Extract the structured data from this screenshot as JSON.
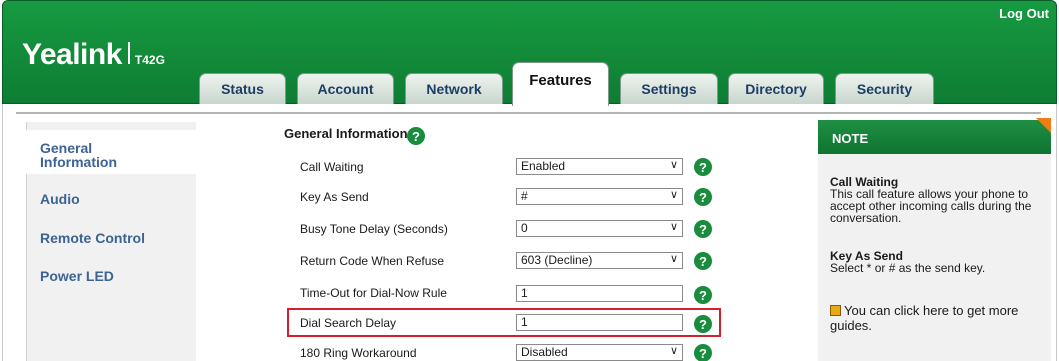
{
  "header": {
    "logout_label": "Log Out",
    "logo_text": "Yealink",
    "model": "T42G"
  },
  "tabs": [
    {
      "label": "Status"
    },
    {
      "label": "Account"
    },
    {
      "label": "Network"
    },
    {
      "label": "Features",
      "active": true
    },
    {
      "label": "Settings"
    },
    {
      "label": "Directory"
    },
    {
      "label": "Security"
    }
  ],
  "sidebar": {
    "items": [
      {
        "label": "General Information",
        "selected": true
      },
      {
        "label": "Audio"
      },
      {
        "label": "Remote Control"
      },
      {
        "label": "Power LED"
      }
    ]
  },
  "section": {
    "title": "General Information",
    "help_icon": "help-icon"
  },
  "rows": [
    {
      "label": "Call Waiting",
      "value": "Enabled",
      "type": "select"
    },
    {
      "label": "Key As Send",
      "value": "#",
      "type": "select"
    },
    {
      "label": "Busy Tone Delay (Seconds)",
      "value": "0",
      "type": "select"
    },
    {
      "label": "Return Code When Refuse",
      "value": "603 (Decline)",
      "type": "select"
    },
    {
      "label": "Time-Out for Dial-Now Rule",
      "value": "1",
      "type": "text"
    },
    {
      "label": "Dial Search Delay",
      "value": "1",
      "type": "text",
      "highlighted": true
    },
    {
      "label": "180 Ring Workaround",
      "value": "Disabled",
      "type": "select"
    }
  ],
  "note": {
    "title": "NOTE",
    "items": [
      {
        "heading": "Call Waiting",
        "text": "This call feature allows your phone to accept other incoming calls during the conversation."
      },
      {
        "heading": "Key As Send",
        "text": "Select * or # as the send key."
      }
    ],
    "guide_text": "You can click here to get more guides."
  },
  "colors": {
    "brand_green": "#179a41",
    "highlight_red": "#d2202e",
    "nav_text": "#3c6394",
    "note_corner": "#f07c12"
  }
}
